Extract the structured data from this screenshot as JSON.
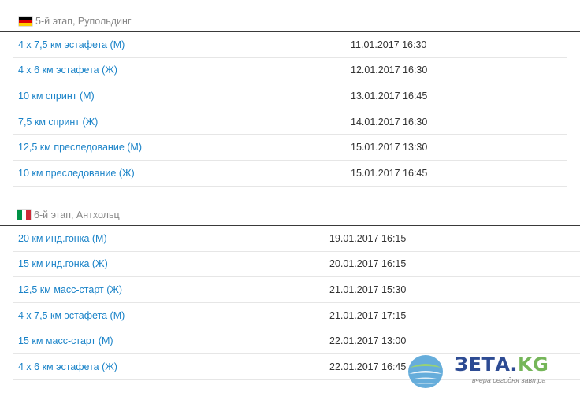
{
  "stages": [
    {
      "title": "5-й этап, Рупольдинг",
      "flag": {
        "name": "germany-flag-icon",
        "colors": [
          "#000000",
          "#dd0000",
          "#ffce00"
        ]
      },
      "races": [
        {
          "name": "4 х 7,5 км эстафета (М)",
          "datetime": "11.01.2017 16:30"
        },
        {
          "name": "4 х 6 км эстафета (Ж)",
          "datetime": "12.01.2017 16:30"
        },
        {
          "name": "10 км спринт (М)",
          "datetime": "13.01.2017 16:45"
        },
        {
          "name": "7,5 км спринт (Ж)",
          "datetime": "14.01.2017 16:30"
        },
        {
          "name": "12,5 км преследование (М)",
          "datetime": "15.01.2017 13:30"
        },
        {
          "name": "10 км преследование (Ж)",
          "datetime": "15.01.2017 16:45"
        }
      ]
    },
    {
      "title": "6-й этап, Антхольц",
      "flag": {
        "name": "italy-flag-icon",
        "colors": [
          "#009246",
          "#ffffff",
          "#ce2b37"
        ]
      },
      "races": [
        {
          "name": "20 км инд.гонка (М)",
          "datetime": "19.01.2017 16:15"
        },
        {
          "name": "15 км инд.гонка (Ж)",
          "datetime": "20.01.2017 16:15"
        },
        {
          "name": "12,5 км масс-старт (Ж)",
          "datetime": "21.01.2017 15:30"
        },
        {
          "name": "4 х 7,5 км эстафета (М)",
          "datetime": "21.01.2017 17:15"
        },
        {
          "name": "15 км масс-старт (М)",
          "datetime": "22.01.2017 13:00"
        },
        {
          "name": "4 х 6 км эстафета (Ж)",
          "datetime": "22.01.2017 16:45"
        }
      ]
    }
  ],
  "watermark": {
    "brand_main": "ЗЕТА.",
    "brand_accent": "KG",
    "tagline": "вчера сегодня завтра"
  },
  "colors": {
    "link": "#1a83c8",
    "text": "#333333",
    "header": "#888888",
    "rule": "#3a3a3a",
    "row_border": "#e6e6e6"
  }
}
